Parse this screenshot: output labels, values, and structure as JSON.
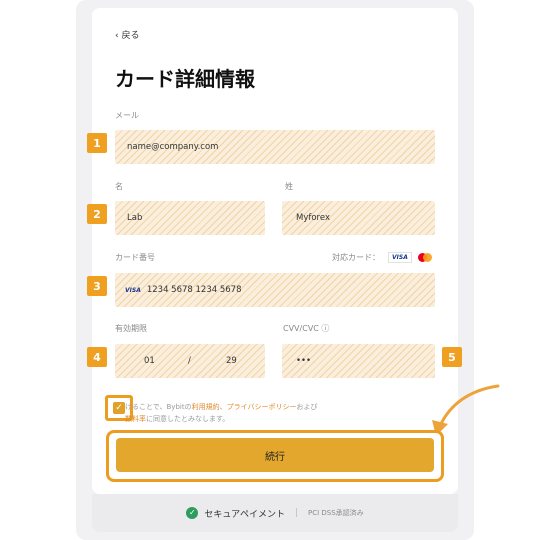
{
  "nav": {
    "back_label": "‹ 戻る"
  },
  "page": {
    "title": "カード詳細情報"
  },
  "email": {
    "label": "メール",
    "value": "name@company.com",
    "badge": "1"
  },
  "name": {
    "first_label": "名",
    "first_value": "Lab",
    "last_label": "姓",
    "last_value": "Myforex",
    "badge": "2"
  },
  "card": {
    "label": "カード番号",
    "supported_label": "対応カード：",
    "visa_text": "VISA",
    "number": "1234 5678 1234 5678",
    "badge": "3"
  },
  "expiry": {
    "label": "有効期限",
    "month": "01",
    "separator": "/",
    "year": "29",
    "badge": "4"
  },
  "cvv": {
    "label": "CVV/CVC ⓘ",
    "value": "•••",
    "badge": "5"
  },
  "terms": {
    "prefix": "けることで、Bybitの",
    "link1": "利用規約",
    "sep1": "、",
    "link2": "プライバシーポリシー",
    "mid": "および",
    "link3": "数料率",
    "suffix": "に同意したとみなします。"
  },
  "actions": {
    "continue_label": "続行"
  },
  "footer": {
    "secure_label": "セキュアペイメント",
    "pci_label": "PCI DSS承認済み"
  },
  "colors": {
    "accent": "#e3a72e",
    "highlight": "#ec9c1f",
    "badge": "#f0a020"
  }
}
